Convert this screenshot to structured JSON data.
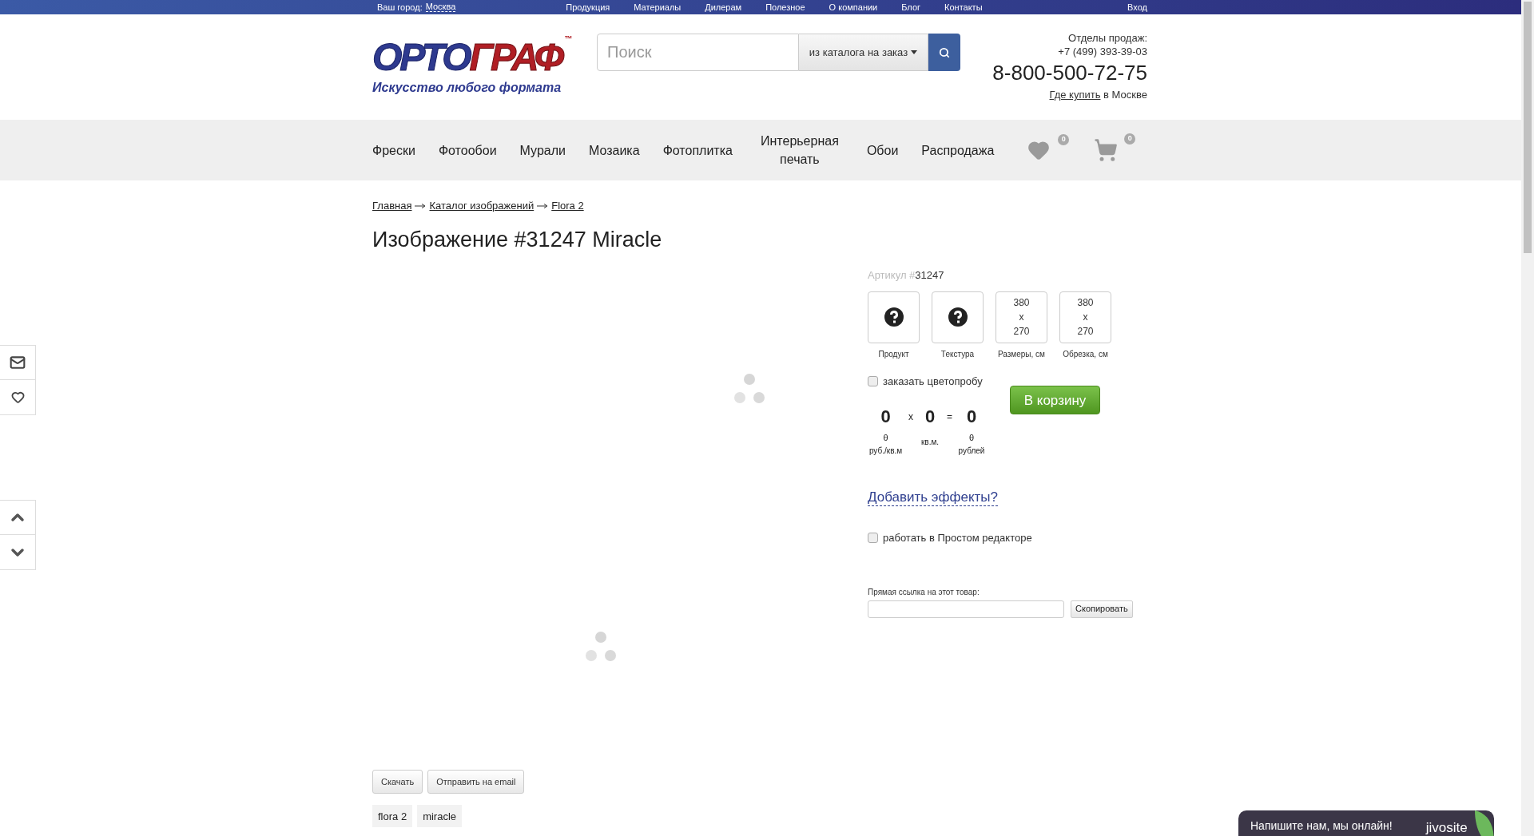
{
  "top_bar": {
    "city_label": "Ваш город:",
    "city": "Москва",
    "links": [
      "Продукция",
      "Материалы",
      "Дилерам",
      "Полезное",
      "О компании",
      "Блог",
      "Контакты"
    ],
    "login": "Вход"
  },
  "header": {
    "logo": {
      "part1": "ОРТО",
      "part2": "ГРАФ",
      "tm": "™",
      "tagline": "Искусство любого формата"
    },
    "search": {
      "placeholder": "Поиск",
      "scope": "из каталога на заказ"
    },
    "contacts": {
      "label": "Отделы продаж:",
      "phone": "+7 (499) 393-39-03",
      "hotline": "8-800-500-72-75",
      "where_link": "Где купить",
      "where_rest": " в Москве"
    }
  },
  "nav": {
    "items": [
      "Фрески",
      "Фотообои",
      "Мурали",
      "Мозаика",
      "Фотоплитка",
      "Интерьерная печать",
      "Обои",
      "Распродажа"
    ],
    "favorites_count": "0",
    "cart_count": "0"
  },
  "breadcrumbs": [
    "Главная",
    "Каталог изображений",
    "Flora 2"
  ],
  "title": "Изображение #31247 Miracle",
  "product": {
    "article_label": "Артикул #",
    "article": "31247",
    "options": [
      {
        "kind": "icon",
        "label": "Продукт"
      },
      {
        "kind": "icon",
        "label": "Текстура"
      },
      {
        "kind": "size",
        "lines": [
          "380",
          "x",
          "270"
        ],
        "label": "Размеры, см"
      },
      {
        "kind": "size",
        "lines": [
          "380",
          "x",
          "270"
        ],
        "label": "Обрезка, см"
      }
    ],
    "proof": {
      "label": "заказать цветопробу",
      "checked": false
    },
    "calc": {
      "price": "0",
      "price_currency": "θ",
      "price_unit": "руб./кв.м",
      "times": "x",
      "area": "0",
      "area_unit": "кв.м.",
      "equals": "=",
      "total": "0",
      "total_currency": "θ",
      "total_unit": "рублей"
    },
    "cart_button": "В корзину",
    "effects_link": "Добавить эффекты?",
    "simple_editor": {
      "label": "работать в Простом редакторе",
      "checked": false
    },
    "direct_link": {
      "label": "Прямая ссылка на этот товар:",
      "copy_button": "Скопировать"
    }
  },
  "image_actions": [
    "Скачать",
    "Отправить на email"
  ],
  "tags": [
    "flora 2",
    "miracle"
  ],
  "chat": {
    "text": "Напишите нам, мы онлайн!",
    "brand": "jivosite"
  }
}
